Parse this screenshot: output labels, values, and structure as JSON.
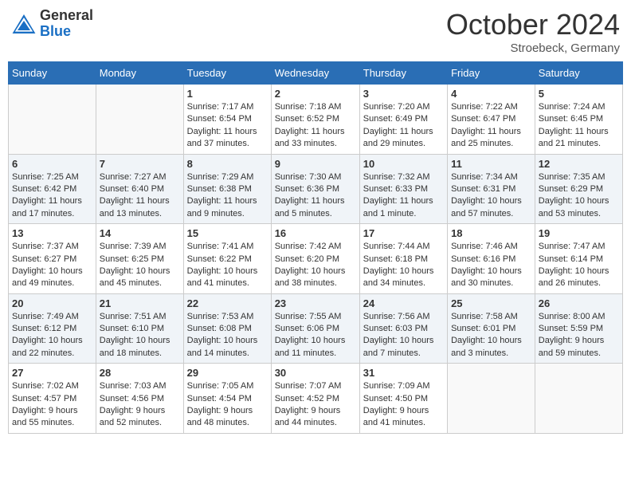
{
  "header": {
    "logo_general": "General",
    "logo_blue": "Blue",
    "month": "October 2024",
    "location": "Stroebeck, Germany"
  },
  "weekdays": [
    "Sunday",
    "Monday",
    "Tuesday",
    "Wednesday",
    "Thursday",
    "Friday",
    "Saturday"
  ],
  "weeks": [
    [
      {
        "day": "",
        "info": ""
      },
      {
        "day": "",
        "info": ""
      },
      {
        "day": "1",
        "info": "Sunrise: 7:17 AM\nSunset: 6:54 PM\nDaylight: 11 hours and 37 minutes."
      },
      {
        "day": "2",
        "info": "Sunrise: 7:18 AM\nSunset: 6:52 PM\nDaylight: 11 hours and 33 minutes."
      },
      {
        "day": "3",
        "info": "Sunrise: 7:20 AM\nSunset: 6:49 PM\nDaylight: 11 hours and 29 minutes."
      },
      {
        "day": "4",
        "info": "Sunrise: 7:22 AM\nSunset: 6:47 PM\nDaylight: 11 hours and 25 minutes."
      },
      {
        "day": "5",
        "info": "Sunrise: 7:24 AM\nSunset: 6:45 PM\nDaylight: 11 hours and 21 minutes."
      }
    ],
    [
      {
        "day": "6",
        "info": "Sunrise: 7:25 AM\nSunset: 6:42 PM\nDaylight: 11 hours and 17 minutes."
      },
      {
        "day": "7",
        "info": "Sunrise: 7:27 AM\nSunset: 6:40 PM\nDaylight: 11 hours and 13 minutes."
      },
      {
        "day": "8",
        "info": "Sunrise: 7:29 AM\nSunset: 6:38 PM\nDaylight: 11 hours and 9 minutes."
      },
      {
        "day": "9",
        "info": "Sunrise: 7:30 AM\nSunset: 6:36 PM\nDaylight: 11 hours and 5 minutes."
      },
      {
        "day": "10",
        "info": "Sunrise: 7:32 AM\nSunset: 6:33 PM\nDaylight: 11 hours and 1 minute."
      },
      {
        "day": "11",
        "info": "Sunrise: 7:34 AM\nSunset: 6:31 PM\nDaylight: 10 hours and 57 minutes."
      },
      {
        "day": "12",
        "info": "Sunrise: 7:35 AM\nSunset: 6:29 PM\nDaylight: 10 hours and 53 minutes."
      }
    ],
    [
      {
        "day": "13",
        "info": "Sunrise: 7:37 AM\nSunset: 6:27 PM\nDaylight: 10 hours and 49 minutes."
      },
      {
        "day": "14",
        "info": "Sunrise: 7:39 AM\nSunset: 6:25 PM\nDaylight: 10 hours and 45 minutes."
      },
      {
        "day": "15",
        "info": "Sunrise: 7:41 AM\nSunset: 6:22 PM\nDaylight: 10 hours and 41 minutes."
      },
      {
        "day": "16",
        "info": "Sunrise: 7:42 AM\nSunset: 6:20 PM\nDaylight: 10 hours and 38 minutes."
      },
      {
        "day": "17",
        "info": "Sunrise: 7:44 AM\nSunset: 6:18 PM\nDaylight: 10 hours and 34 minutes."
      },
      {
        "day": "18",
        "info": "Sunrise: 7:46 AM\nSunset: 6:16 PM\nDaylight: 10 hours and 30 minutes."
      },
      {
        "day": "19",
        "info": "Sunrise: 7:47 AM\nSunset: 6:14 PM\nDaylight: 10 hours and 26 minutes."
      }
    ],
    [
      {
        "day": "20",
        "info": "Sunrise: 7:49 AM\nSunset: 6:12 PM\nDaylight: 10 hours and 22 minutes."
      },
      {
        "day": "21",
        "info": "Sunrise: 7:51 AM\nSunset: 6:10 PM\nDaylight: 10 hours and 18 minutes."
      },
      {
        "day": "22",
        "info": "Sunrise: 7:53 AM\nSunset: 6:08 PM\nDaylight: 10 hours and 14 minutes."
      },
      {
        "day": "23",
        "info": "Sunrise: 7:55 AM\nSunset: 6:06 PM\nDaylight: 10 hours and 11 minutes."
      },
      {
        "day": "24",
        "info": "Sunrise: 7:56 AM\nSunset: 6:03 PM\nDaylight: 10 hours and 7 minutes."
      },
      {
        "day": "25",
        "info": "Sunrise: 7:58 AM\nSunset: 6:01 PM\nDaylight: 10 hours and 3 minutes."
      },
      {
        "day": "26",
        "info": "Sunrise: 8:00 AM\nSunset: 5:59 PM\nDaylight: 9 hours and 59 minutes."
      }
    ],
    [
      {
        "day": "27",
        "info": "Sunrise: 7:02 AM\nSunset: 4:57 PM\nDaylight: 9 hours and 55 minutes."
      },
      {
        "day": "28",
        "info": "Sunrise: 7:03 AM\nSunset: 4:56 PM\nDaylight: 9 hours and 52 minutes."
      },
      {
        "day": "29",
        "info": "Sunrise: 7:05 AM\nSunset: 4:54 PM\nDaylight: 9 hours and 48 minutes."
      },
      {
        "day": "30",
        "info": "Sunrise: 7:07 AM\nSunset: 4:52 PM\nDaylight: 9 hours and 44 minutes."
      },
      {
        "day": "31",
        "info": "Sunrise: 7:09 AM\nSunset: 4:50 PM\nDaylight: 9 hours and 41 minutes."
      },
      {
        "day": "",
        "info": ""
      },
      {
        "day": "",
        "info": ""
      }
    ]
  ]
}
